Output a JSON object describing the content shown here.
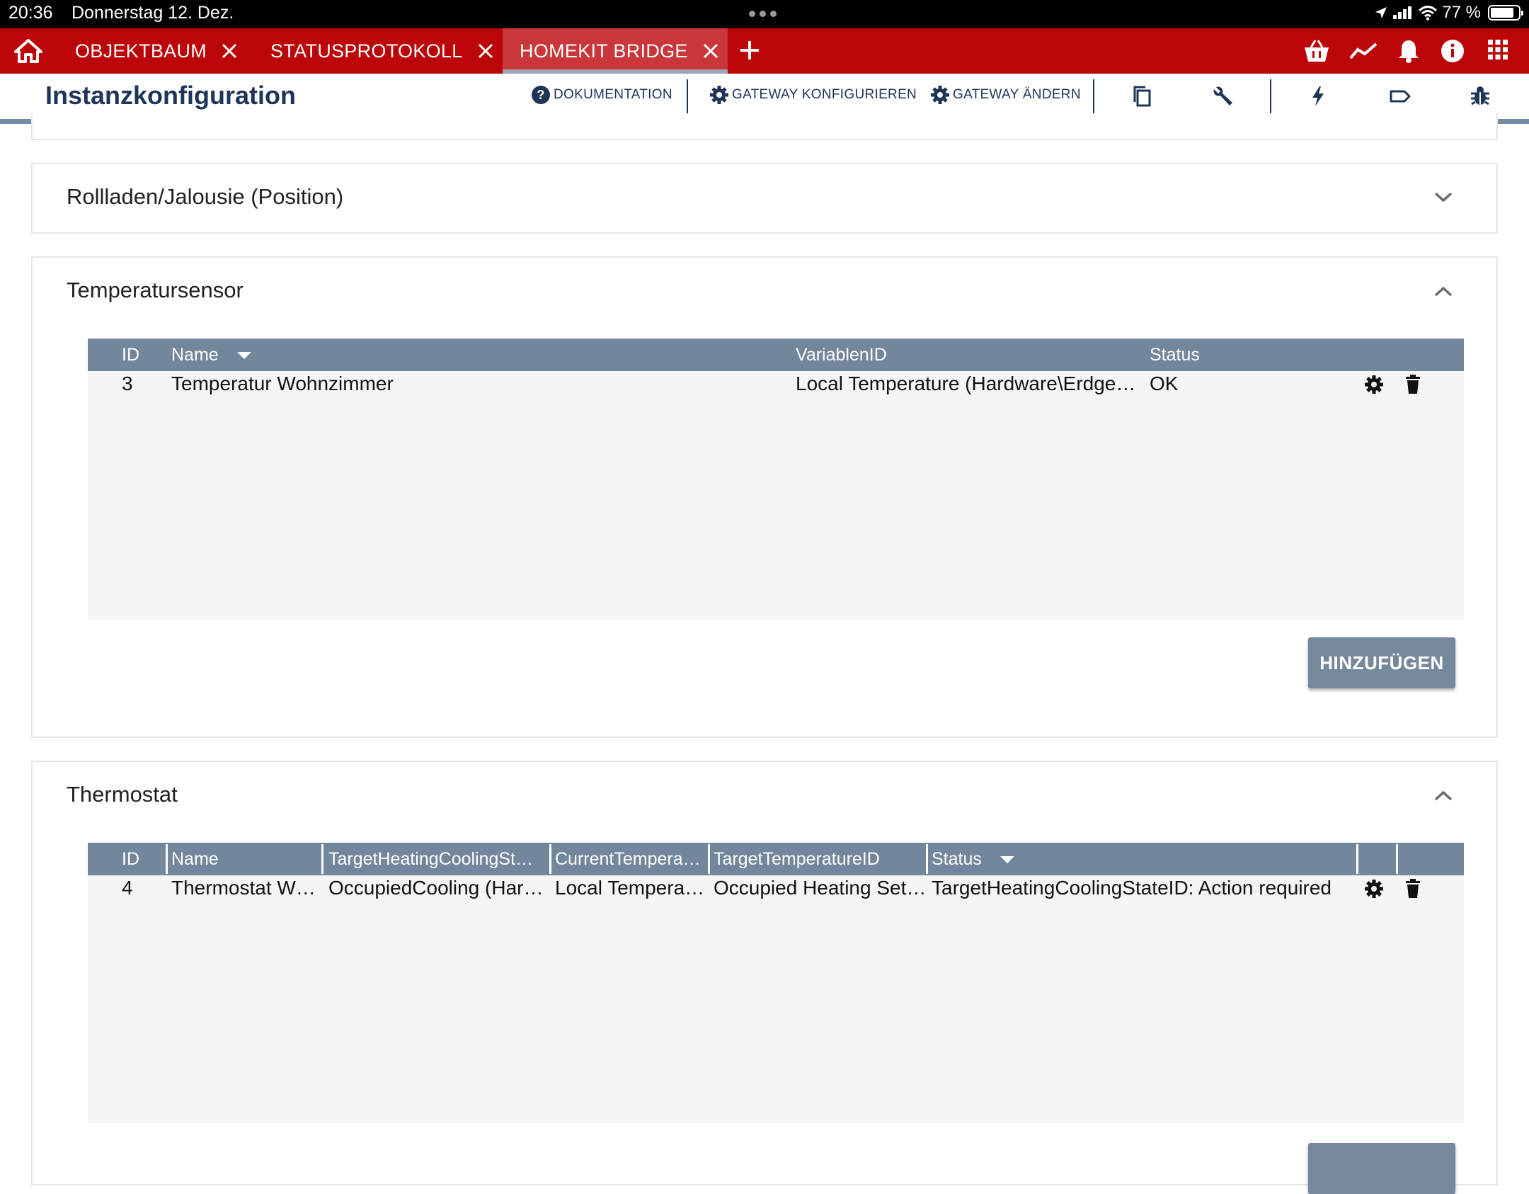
{
  "status_bar": {
    "time": "20:36",
    "date": "Donnerstag 12. Dez.",
    "battery": "77 %"
  },
  "tabs": [
    {
      "label": "OBJEKTBAUM",
      "active": false
    },
    {
      "label": "STATUSPROTOKOLL",
      "active": false
    },
    {
      "label": "HOMEKIT BRIDGE",
      "active": true
    }
  ],
  "toolbar": {
    "title": "Instanzkonfiguration",
    "doc_label": "DOKUMENTATION",
    "gateway_config_label": "GATEWAY KONFIGURIEREN",
    "gateway_change_label": "GATEWAY ÄNDERN"
  },
  "sections": {
    "rollladen": {
      "title": "Rollladen/Jalousie (Position)",
      "expanded": false
    },
    "temperatursensor": {
      "title": "Temperatursensor",
      "expanded": true,
      "columns": [
        "ID",
        "Name",
        "VariablenID",
        "Status"
      ],
      "rows": [
        {
          "id": "3",
          "name": "Temperatur Wohnzimmer",
          "variable": "Local Temperature (Hardware\\Erdge…",
          "status": "OK"
        }
      ],
      "add_label": "HINZUFÜGEN"
    },
    "thermostat": {
      "title": "Thermostat",
      "expanded": true,
      "columns": [
        "ID",
        "Name",
        "TargetHeatingCoolingSt…",
        "CurrentTempera…",
        "TargetTemperatureID",
        "Status"
      ],
      "rows": [
        {
          "id": "4",
          "name": "Thermostat W…",
          "target_hc": "OccupiedCooling (Har…",
          "current_temp": "Local Tempera…",
          "target_temp": "Occupied Heating Set…",
          "status": "TargetHeatingCoolingStateID: Action required"
        }
      ]
    }
  },
  "colors": {
    "tab_bar": "#bb0508",
    "active_tab": "#c9373b",
    "toolbar_text": "#1e3558",
    "table_header": "#72879b",
    "add_button": "#76889b"
  }
}
